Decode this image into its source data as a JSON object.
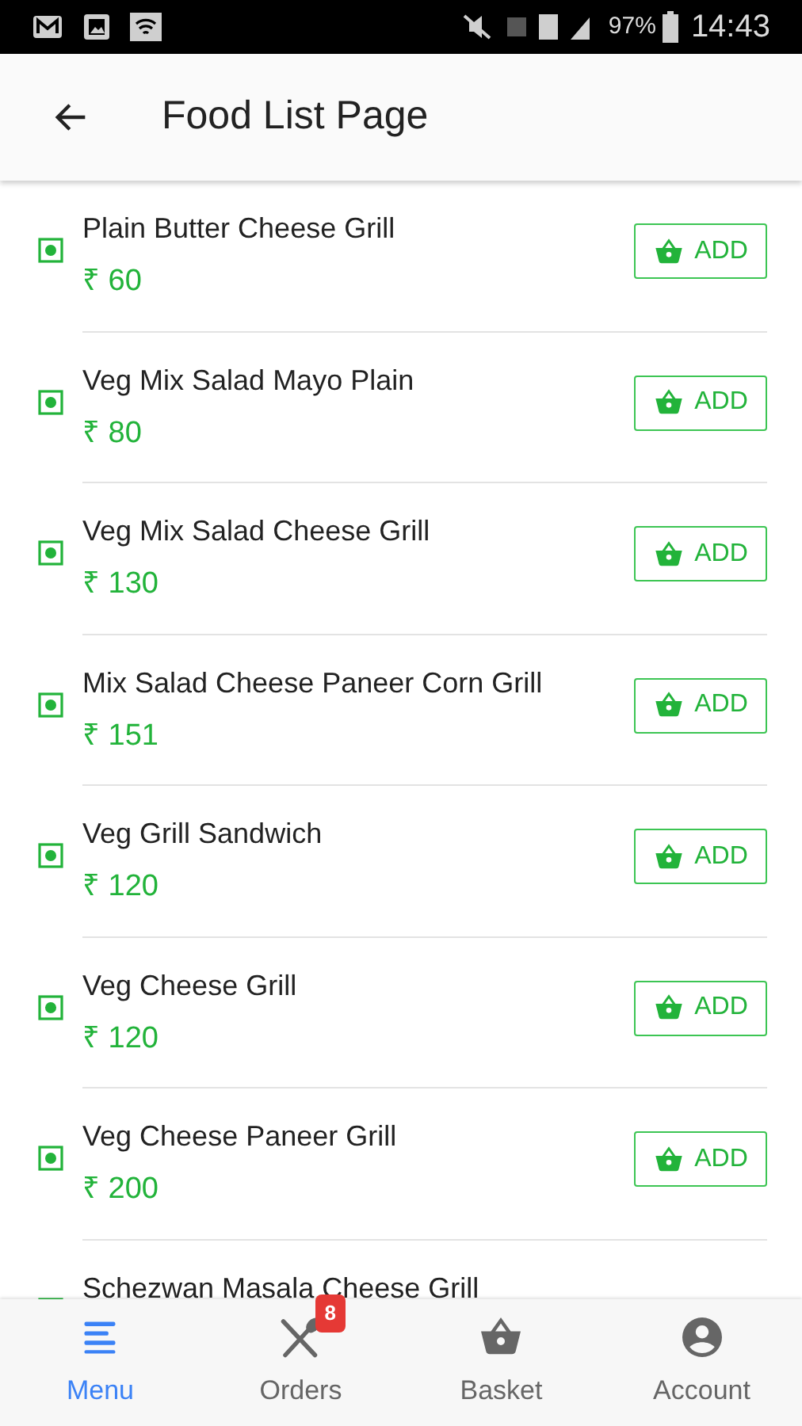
{
  "status_bar": {
    "battery": "97%",
    "time": "14:43"
  },
  "header": {
    "title": "Food List Page"
  },
  "items": [
    {
      "name": "Plain Butter Cheese Grill",
      "price": "₹ 60",
      "button": "ADD"
    },
    {
      "name": "Veg Mix Salad Mayo Plain",
      "price": "₹ 80",
      "button": "ADD"
    },
    {
      "name": "Veg Mix Salad Cheese Grill",
      "price": "₹ 130",
      "button": "ADD"
    },
    {
      "name": "Mix Salad Cheese Paneer Corn Grill",
      "price": "₹ 151",
      "button": "ADD"
    },
    {
      "name": "Veg Grill Sandwich",
      "price": "₹ 120",
      "button": "ADD"
    },
    {
      "name": "Veg Cheese Grill",
      "price": "₹ 120",
      "button": "ADD"
    },
    {
      "name": "Veg Cheese Paneer Grill",
      "price": "₹ 200",
      "button": "ADD"
    },
    {
      "name": "Schezwan Masala Cheese Grill"
    }
  ],
  "bottom_nav": [
    {
      "label": "Menu",
      "kind": "menu",
      "selected": true
    },
    {
      "label": "Orders",
      "kind": "orders",
      "selected": false,
      "badge": "8"
    },
    {
      "label": "Basket",
      "kind": "basket",
      "selected": false
    },
    {
      "label": "Account",
      "kind": "account",
      "selected": false
    }
  ]
}
